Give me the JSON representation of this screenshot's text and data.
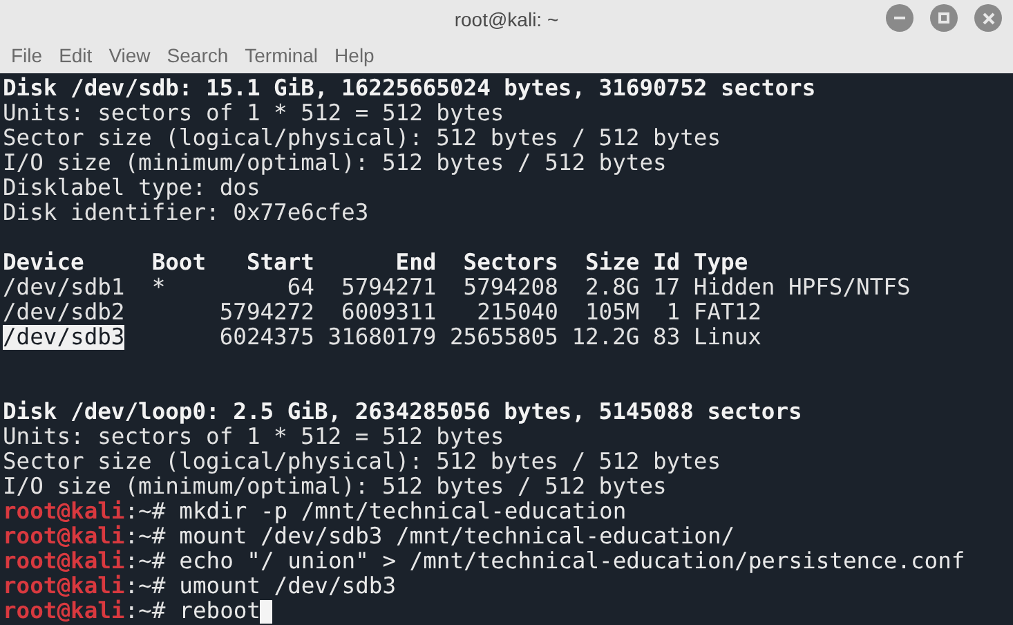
{
  "window": {
    "title": "root@kali: ~"
  },
  "menu": [
    "File",
    "Edit",
    "View",
    "Search",
    "Terminal",
    "Help"
  ],
  "terminal": {
    "lines": [
      {
        "kind": "bold",
        "text": "Disk /dev/sdb: 15.1 GiB, 16225665024 bytes, 31690752 sectors"
      },
      {
        "kind": "text",
        "text": "Units: sectors of 1 * 512 = 512 bytes"
      },
      {
        "kind": "text",
        "text": "Sector size (logical/physical): 512 bytes / 512 bytes"
      },
      {
        "kind": "text",
        "text": "I/O size (minimum/optimal): 512 bytes / 512 bytes"
      },
      {
        "kind": "text",
        "text": "Disklabel type: dos"
      },
      {
        "kind": "text",
        "text": "Disk identifier: 0x77e6cfe3"
      },
      {
        "kind": "blank"
      },
      {
        "kind": "bold",
        "text": "Device     Boot   Start      End  Sectors  Size Id Type"
      },
      {
        "kind": "text",
        "text": "/dev/sdb1  *         64  5794271  5794208  2.8G 17 Hidden HPFS/NTFS"
      },
      {
        "kind": "text",
        "text": "/dev/sdb2       5794272  6009311   215040  105M  1 FAT12"
      },
      {
        "kind": "selected",
        "selection": "/dev/sdb3",
        "text": "       6024375 31680179 25655805 12.2G 83 Linux"
      },
      {
        "kind": "blank"
      },
      {
        "kind": "blank"
      },
      {
        "kind": "bold",
        "text": "Disk /dev/loop0: 2.5 GiB, 2634285056 bytes, 5145088 sectors"
      },
      {
        "kind": "text",
        "text": "Units: sectors of 1 * 512 = 512 bytes"
      },
      {
        "kind": "text",
        "text": "Sector size (logical/physical): 512 bytes / 512 bytes"
      },
      {
        "kind": "text",
        "text": "I/O size (minimum/optimal): 512 bytes / 512 bytes"
      },
      {
        "kind": "prompt",
        "prompt": "root@kali",
        "path": ":~#",
        "text": "mkdir -p /mnt/technical-education"
      },
      {
        "kind": "prompt",
        "prompt": "root@kali",
        "path": ":~#",
        "text": "mount /dev/sdb3 /mnt/technical-education/"
      },
      {
        "kind": "prompt",
        "prompt": "root@kali",
        "path": ":~#",
        "text": "echo \"/ union\" > /mnt/technical-education/persistence.conf"
      },
      {
        "kind": "prompt",
        "prompt": "root@kali",
        "path": ":~#",
        "text": "umount /dev/sdb3"
      },
      {
        "kind": "prompt",
        "prompt": "root@kali",
        "path": ":~#",
        "text": "reboot",
        "cursor": true
      }
    ]
  }
}
